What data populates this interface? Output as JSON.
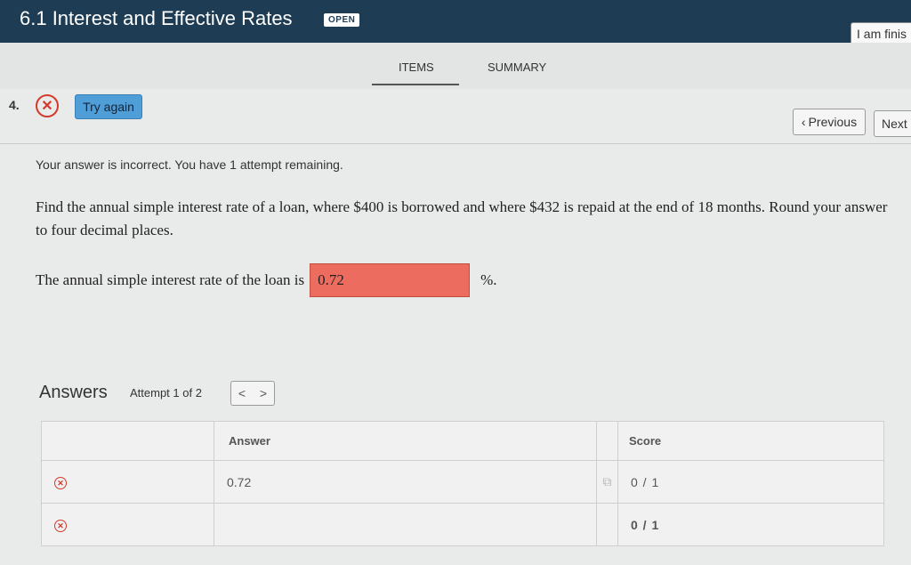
{
  "header": {
    "title": "6.1 Interest and Effective Rates",
    "badge": "OPEN",
    "finish_button": "I am finis"
  },
  "tabs": {
    "items": "ITEMS",
    "summary": "SUMMARY"
  },
  "nav": {
    "question_number": "4.",
    "try_again": "Try again",
    "previous": "Previous",
    "next": "Next"
  },
  "question": {
    "feedback": "Your answer is incorrect. You have 1 attempt remaining.",
    "prompt": "Find the annual simple interest rate of a loan, where $400 is borrowed and where $432 is repaid at the end of 18 months. Round your answer to four decimal places.",
    "answer_label": "The annual simple interest rate of the loan is",
    "answer_value": "0.72",
    "unit": "%."
  },
  "answers": {
    "heading": "Answers",
    "attempt": "Attempt 1 of 2",
    "columns": {
      "answer": "Answer",
      "score": "Score"
    },
    "rows": [
      {
        "answer": "0.72",
        "score": "0 / 1"
      },
      {
        "answer": "",
        "score": "0 / 1"
      }
    ]
  },
  "colors": {
    "header_bg": "#1e3d55",
    "incorrect_red": "#d33a2c",
    "wrong_input_bg": "#ec6d5f",
    "try_again_blue": "#4f9ed8"
  }
}
